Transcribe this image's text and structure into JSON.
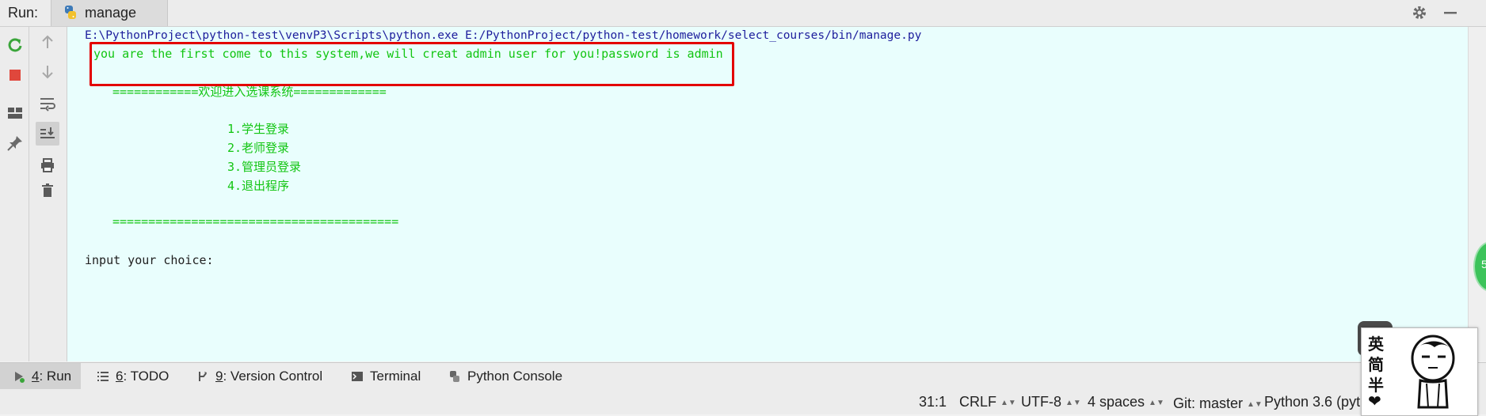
{
  "run_header": {
    "label": "Run:",
    "tab_name": "manage"
  },
  "icons": {
    "python": "python-icon",
    "rerun": "rerun-icon",
    "stop": "stop-icon",
    "layout": "layout-icon",
    "pin": "pin-icon",
    "up": "arrow-up-icon",
    "down": "arrow-down-icon",
    "wrap": "soft-wrap-icon",
    "scroll_end": "scroll-to-end-icon",
    "print": "print-icon",
    "trash": "trash-icon",
    "settings": "gear-icon",
    "minimize": "minimize-icon"
  },
  "console": {
    "command": "E:\\PythonProject\\python-test\\venvP3\\Scripts\\python.exe E:/PythonProject/python-test/homework/select_courses/bin/manage.py",
    "first_run_message": "you are the first come to this system,we will creat admin user for you!password is admin",
    "banner_top": "============欢迎进入选课系统=============",
    "menu": [
      "1.学生登录",
      "2.老师登录",
      "3.管理员登录",
      "4.退出程序"
    ],
    "banner_bottom": "========================================",
    "prompt": "input your choice:"
  },
  "tool_windows": [
    {
      "key": "4",
      "label": ": Run"
    },
    {
      "key": "6",
      "label": ": TODO"
    },
    {
      "key": "9",
      "label": ": Version Control"
    },
    {
      "key": "",
      "label": "Terminal"
    },
    {
      "key": "",
      "label": "Python Console"
    }
  ],
  "status": {
    "position": "31:1",
    "line_sep": "CRLF",
    "encoding": "UTF-8",
    "indent": "4 spaces",
    "git": "Git: master",
    "interpreter": "Python 3.6 (pyth"
  },
  "badge": "5",
  "sticker": [
    "英",
    "简",
    "半",
    "❤"
  ],
  "colors": {
    "console_bg": "#e9fefd",
    "command": "#1c1c9c",
    "output_green": "#11c511",
    "highlight_box": "#e30000"
  }
}
